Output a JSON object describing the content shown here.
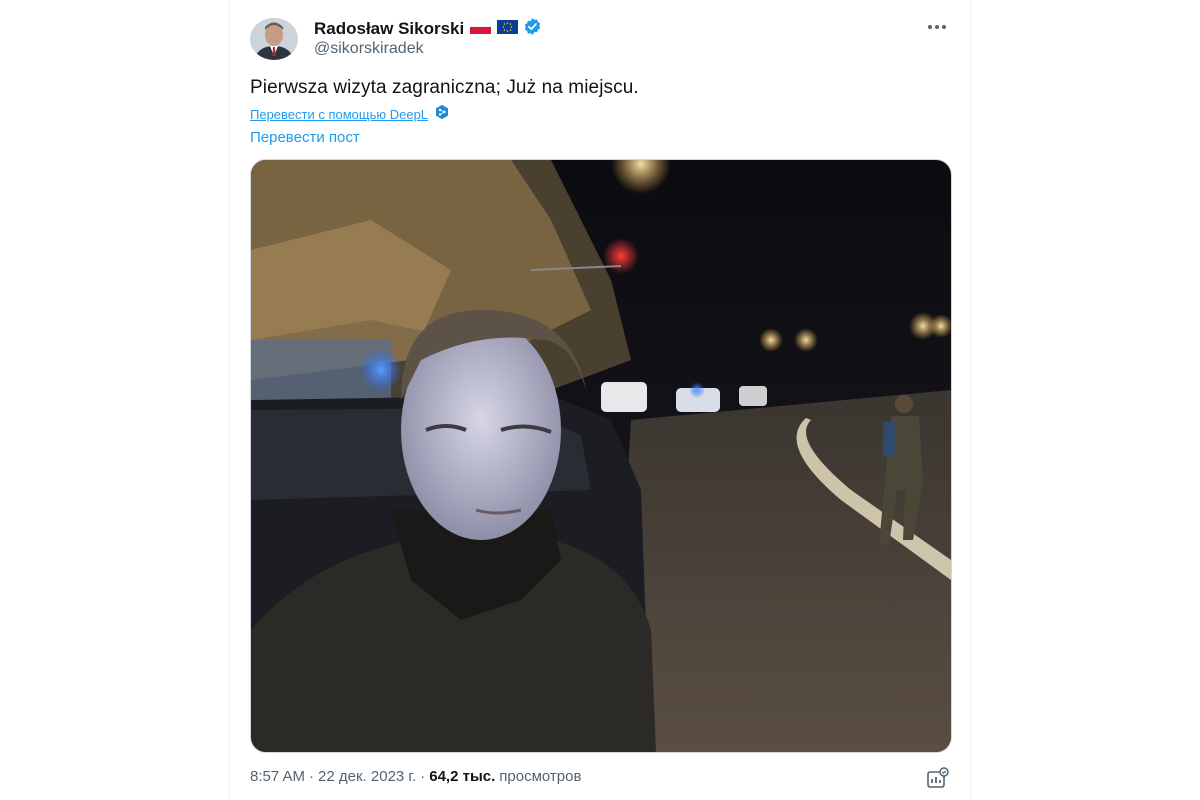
{
  "tweet": {
    "author": {
      "name": "Radosław Sikorski",
      "handle": "@sikorskiradek",
      "verified": true
    },
    "text": "Pierwsza wizyta zagraniczna; Już na miejscu.",
    "translate_deepl_label": "Перевести с помощью DeepL",
    "translate_post_label": "Перевести пост",
    "footer": {
      "time": "8:57 AM",
      "separator": "·",
      "date": "22 дек. 2023 г.",
      "views_count": "64,2 тыс.",
      "views_label": "просмотров"
    }
  },
  "icons": {
    "more": "more-horizontal-icon",
    "verified": "verified-badge-icon",
    "poland_flag": "poland-flag-icon",
    "eu_flag": "eu-flag-icon",
    "deepl": "deepl-icon",
    "analytics": "analytics-icon"
  },
  "colors": {
    "accent": "#1d9bf0",
    "text": "#0f1419",
    "secondary": "#536471"
  }
}
